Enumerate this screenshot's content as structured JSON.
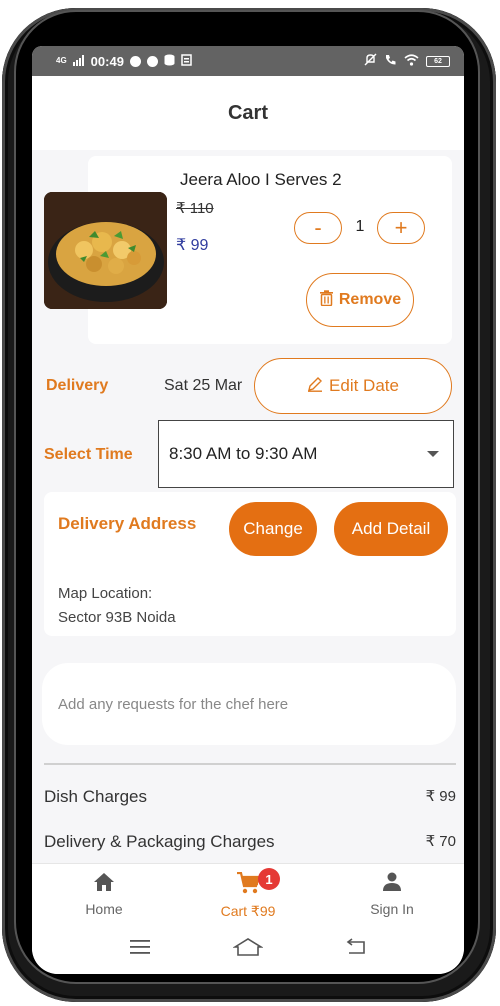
{
  "status_bar": {
    "network": "4G",
    "time": "00:49",
    "battery": "62"
  },
  "header": {
    "title": "Cart"
  },
  "cart_item": {
    "name": "Jeera Aloo I Serves 2",
    "original_price": "₹ 110",
    "price": "₹ 99",
    "quantity": "1",
    "minus_label": "-",
    "plus_label": "+",
    "remove_label": "Remove"
  },
  "delivery": {
    "label": "Delivery",
    "date": "Sat 25 Mar",
    "edit_label": "Edit Date"
  },
  "time_select": {
    "label": "Select Time",
    "value": "8:30 AM to 9:30 AM"
  },
  "address": {
    "title": "Delivery Address",
    "change_label": "Change",
    "add_detail_label": "Add Detail",
    "map_label": "Map Location:",
    "map_value": "Sector 93B Noida"
  },
  "chef_request": {
    "placeholder": "Add any requests for the chef here"
  },
  "charges": [
    {
      "label": "Dish Charges",
      "amount": "₹ 99"
    },
    {
      "label": "Delivery & Packaging Charges",
      "amount": "₹ 70"
    }
  ],
  "bottom_nav": [
    {
      "label": "Home",
      "icon": "home-icon"
    },
    {
      "label": "Cart ₹99",
      "icon": "cart-icon",
      "badge": "1",
      "active": true
    },
    {
      "label": "Sign In",
      "icon": "person-icon"
    }
  ],
  "colors": {
    "accent": "#e07a1f",
    "accent_solid": "#e46f12",
    "price_blue": "#2f3b9e",
    "badge_red": "#e53935"
  }
}
